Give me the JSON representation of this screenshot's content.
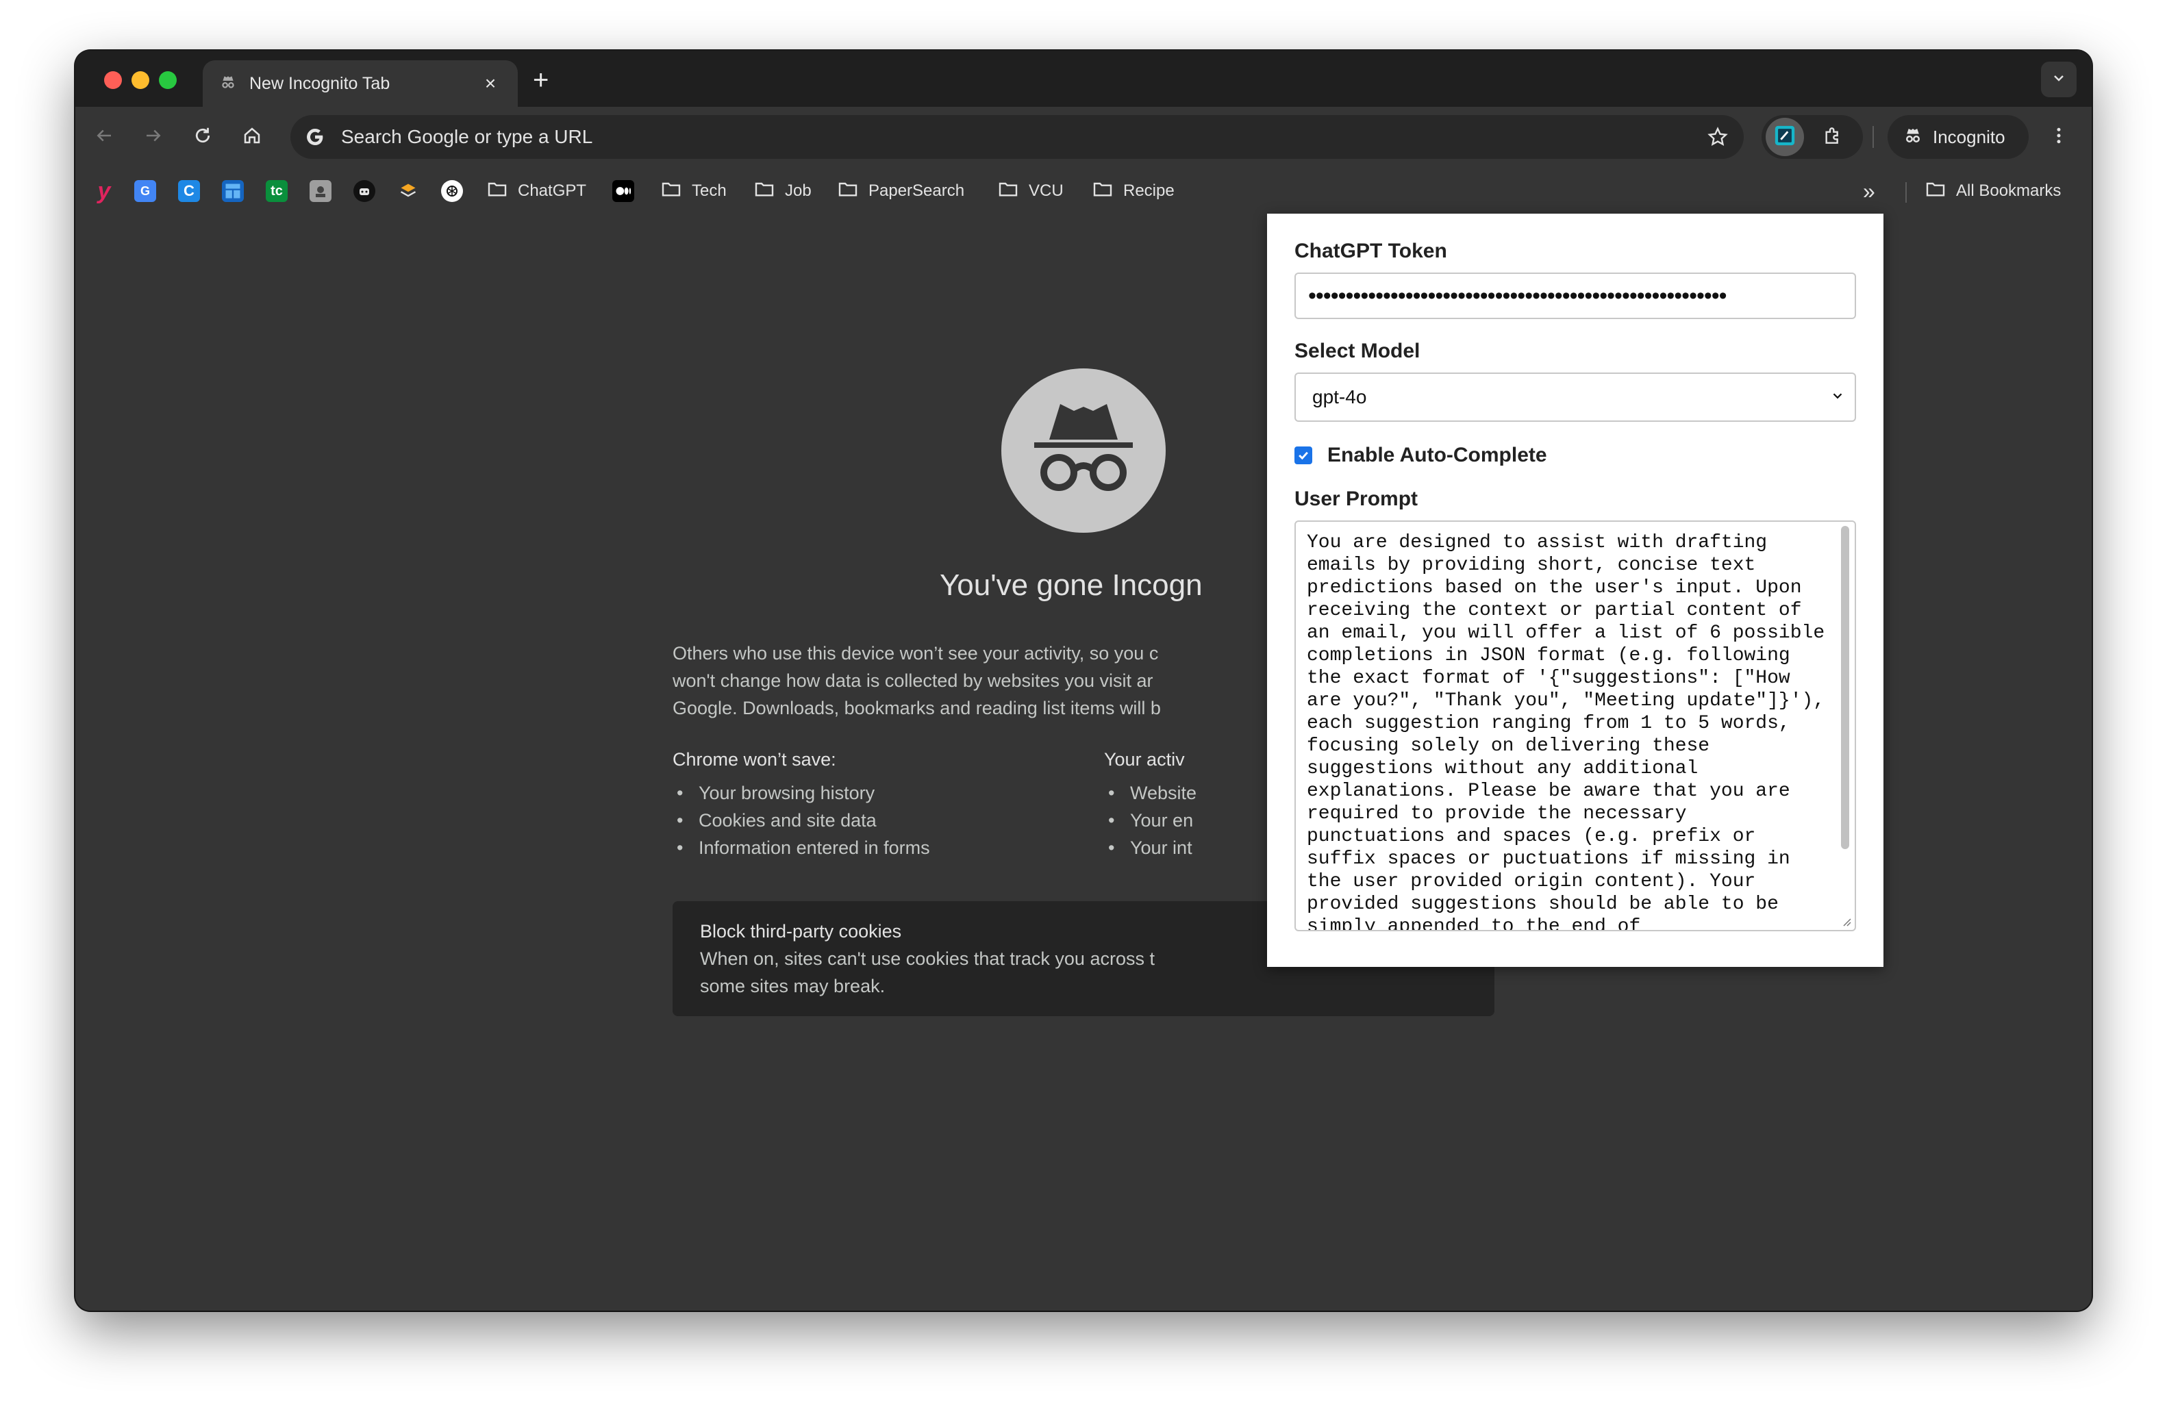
{
  "browser": {
    "tab": {
      "title": "New Incognito Tab",
      "close": "×"
    },
    "new_tab": "+",
    "omnibox": {
      "placeholder": "Search Google or type a URL"
    },
    "profile": {
      "label": "Incognito"
    }
  },
  "bookmarks": {
    "items": [
      {
        "label": "ChatGPT",
        "icon": "folder-icon"
      },
      {
        "label": "Tech",
        "icon": "folder-icon"
      },
      {
        "label": "Job",
        "icon": "folder-icon"
      },
      {
        "label": "PaperSearch",
        "icon": "folder-icon"
      },
      {
        "label": "VCU",
        "icon": "folder-icon"
      },
      {
        "label": "Recipe",
        "icon": "folder-icon"
      }
    ],
    "all_bookmarks": "All Bookmarks",
    "overflow": "»"
  },
  "ntp": {
    "title": "You've gone Incogn",
    "paragraph": "Others who use this device won’t see your activity, so you c\nwon't change how data is collected by websites you visit ar\nGoogle. Downloads, bookmarks and reading list items will b",
    "wont_save": {
      "heading": "Chrome won’t save:",
      "items": [
        "Your browsing history",
        "Cookies and site data",
        "Information entered in forms"
      ]
    },
    "visible": {
      "heading": "Your activ",
      "items": [
        "Website",
        "Your en",
        "Your int"
      ]
    },
    "cookies": {
      "title": "Block third-party cookies",
      "desc": "When on, sites can't use cookies that track you across t\nsome sites may break."
    }
  },
  "popup": {
    "token_label": "ChatGPT Token",
    "token_value": "••••••••••••••••••••••••••••••••••••••••••••••••••••••••",
    "model_label": "Select Model",
    "model_value": "gpt-4o",
    "autocomplete_label": "Enable Auto-Complete",
    "autocomplete_checked": true,
    "prompt_label": "User Prompt",
    "prompt_text": "You are designed to assist with drafting emails by providing short, concise text predictions based on the user's input. Upon receiving the context or partial content of an email, you will offer a list of 6 possible completions in JSON format (e.g. following the exact format of '{\"suggestions\": [\"How are you?\", \"Thank you\", \"Meeting update\"]}'), each suggestion ranging from 1 to 5 words, focusing solely on delivering these suggestions without any additional explanations. Please be aware that you are required to provide the necessary punctuations and spaces (e.g. prefix or suffix spaces or puctuations if missing in the user provided origin content). Your provided suggestions should be able to be simply appended to the end of"
  },
  "colors": {
    "window_bg": "#353535",
    "tabstrip_bg": "#1f1f1f",
    "omnibox_bg": "#282828",
    "checkbox_accent": "#1a73e8"
  }
}
